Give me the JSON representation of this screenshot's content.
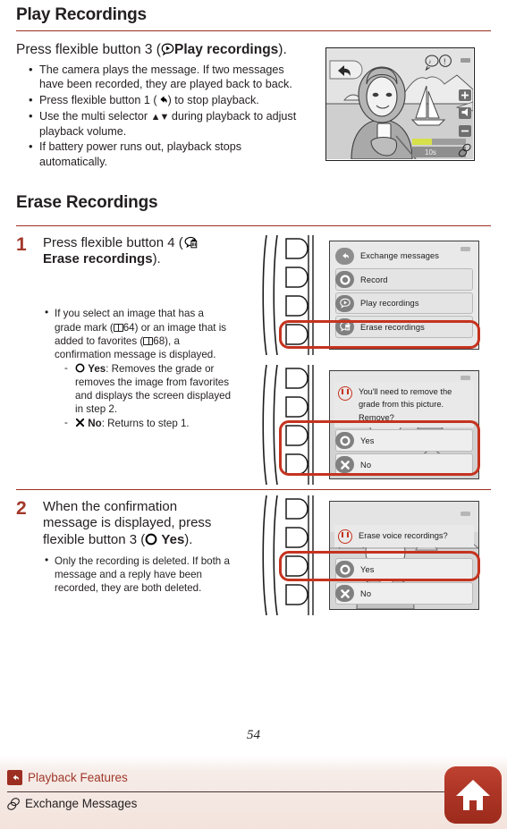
{
  "page": {
    "number": "54"
  },
  "section1": {
    "title": "Play Recordings",
    "lead_prefix": "Press flexible button 3 (",
    "lead_icon": "play-bubble-icon",
    "lead_bold": "Play recordings",
    "lead_suffix": ").",
    "bullets": [
      "The camera plays the message. If two messages have been recorded, they are played back to back.",
      "Press flexible button 1 (↩) to stop playback.",
      "Use the multi selector ▲▼ during playback to adjust playback volume.",
      "If battery power runs out, playback stops automatically."
    ],
    "bullet2_prefix": "Press flexible button 1 (",
    "bullet2_suffix": ") to stop playback.",
    "bullet3_prefix": "Use the multi selector ",
    "bullet3_arrows": "▲▼",
    "bullet3_suffix": " during playback to adjust playback volume.",
    "illustration": {
      "name": "playback-screen",
      "icons": [
        "mute-bubble-icon",
        "info-bubble-icon",
        "battery-icon",
        "back-arrow-icon",
        "zoom-in-icon",
        "speaker-icon",
        "zoom-out-icon",
        "link-icon"
      ],
      "counter": "10s"
    }
  },
  "section2": {
    "title": "Erase Recordings",
    "steps": [
      {
        "num": "1",
        "head_prefix": "Press flexible button 4 (",
        "head_icon": "erase-recordings-icon",
        "head_bold": "Erase recordings",
        "head_suffix": ").",
        "bullets": [
          {
            "text_parts": [
              "If you select an image that has a grade mark (",
              "64",
              ") or an image that is added to favorites (",
              "68",
              "), a confirmation message is displayed."
            ],
            "ref1": "64",
            "ref2": "68",
            "sub": [
              {
                "icon": "circle-icon",
                "label": "Yes",
                "text": ": Removes the grade or removes the image from favorites and displays the screen displayed in step 2."
              },
              {
                "icon": "cross-icon",
                "label": "No",
                "text": ": Returns to step 1."
              }
            ]
          }
        ],
        "figure": {
          "name": "menu-screen",
          "menu_items": [
            {
              "icon": "back-arrow-icon",
              "label": "Exchange messages",
              "highlighted": false
            },
            {
              "icon": "record-icon",
              "label": "Record",
              "highlighted": false
            },
            {
              "icon": "play-bubble-icon",
              "label": "Play recordings",
              "highlighted": false
            },
            {
              "icon": "erase-recordings-icon",
              "label": "Erase recordings",
              "highlighted": true
            }
          ]
        },
        "figure2": {
          "name": "remove-grade-confirm-screen",
          "message": "You'll need to remove the grade from this picture. Remove?",
          "options": [
            {
              "icon": "circle-icon",
              "label": "Yes"
            },
            {
              "icon": "cross-icon",
              "label": "No"
            }
          ]
        }
      },
      {
        "num": "2",
        "head_prefix": "When the confirmation message is displayed, press flexible button 3 (",
        "head_icon": "circle-icon",
        "head_bold": "Yes",
        "head_suffix": ").",
        "bullets": [
          "Only the recording is deleted. If both a message and a reply have been recorded, they are both deleted."
        ],
        "figure": {
          "name": "erase-voice-confirm-screen",
          "message": "Erase voice recordings?",
          "options": [
            {
              "icon": "circle-icon",
              "label": "Yes"
            },
            {
              "icon": "cross-icon",
              "label": "No"
            }
          ]
        }
      }
    ]
  },
  "footer": {
    "breadcrumb_back_icon": "back-arrow-icon",
    "breadcrumb_parent": "Playback Features",
    "breadcrumb_child_icon": "exchange-messages-icon",
    "breadcrumb_child": "Exchange Messages",
    "home_icon": "home-icon"
  },
  "colors": {
    "accent_rule": "#9c2f22",
    "step_number": "#a3382a",
    "highlight_box": "#c5331f",
    "home_button": "#ad3526"
  }
}
